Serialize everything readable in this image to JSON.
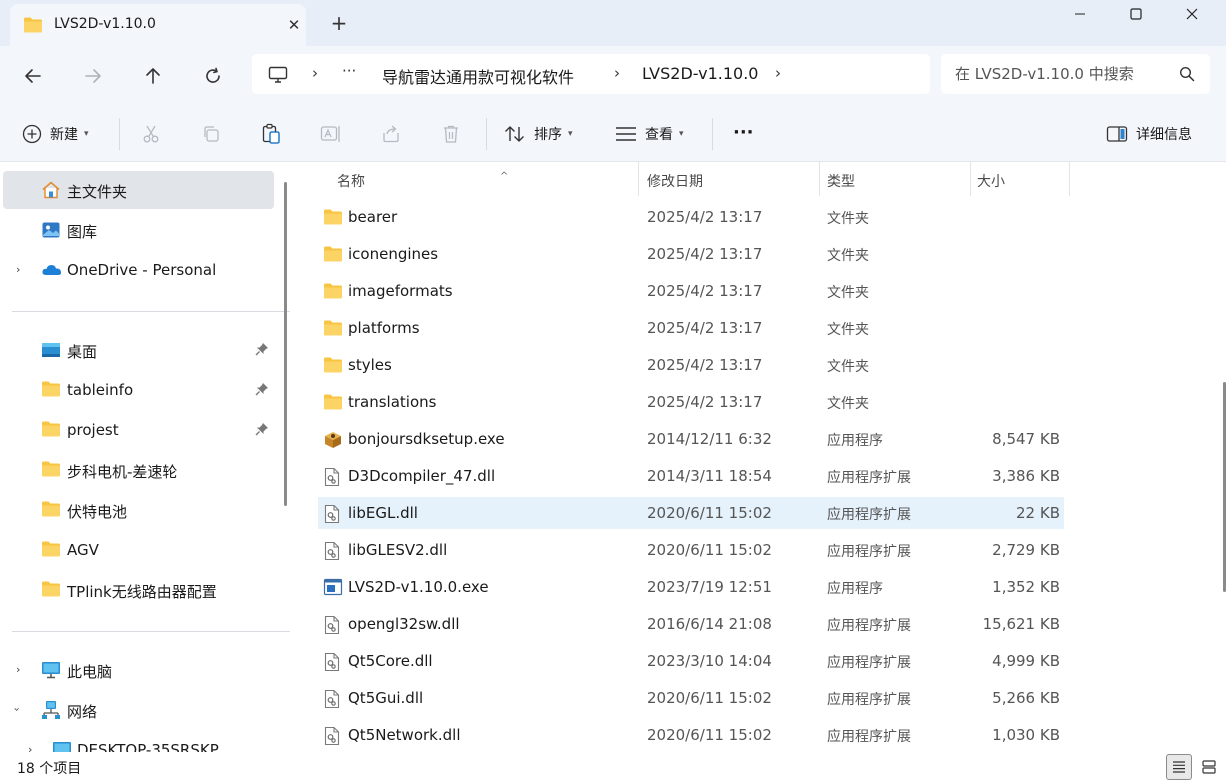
{
  "window": {
    "tab_title": "LVS2D-v1.10.0",
    "close_tab": "✕",
    "new_tab": "+"
  },
  "address": {
    "ellipsis": "···",
    "crumbs": [
      "导航雷达通用款可视化软件",
      "LVS2D-v1.10.0"
    ],
    "separator": "›"
  },
  "search": {
    "placeholder": "在 LVS2D-v1.10.0 中搜索"
  },
  "toolbar": {
    "new_label": "新建",
    "sort_label": "排序",
    "view_label": "查看",
    "more_label": "···",
    "details_label": "详细信息"
  },
  "sidebar": {
    "items": [
      {
        "label": "主文件夹",
        "icon": "home-icon"
      },
      {
        "label": "图库",
        "icon": "gallery-icon"
      },
      {
        "label": "OneDrive - Personal",
        "icon": "onedrive-icon"
      },
      {
        "label": "桌面",
        "icon": "desktop-icon"
      },
      {
        "label": "tableinfo",
        "icon": "folder-icon"
      },
      {
        "label": "projest",
        "icon": "folder-icon"
      },
      {
        "label": "步科电机-差速轮",
        "icon": "folder-icon"
      },
      {
        "label": "伏特电池",
        "icon": "folder-icon"
      },
      {
        "label": "AGV",
        "icon": "folder-icon"
      },
      {
        "label": "TPlink无线路由器配置",
        "icon": "folder-icon"
      },
      {
        "label": "此电脑",
        "icon": "pc-icon"
      },
      {
        "label": "网络",
        "icon": "network-icon"
      },
      {
        "label": "DESKTOP-35SRSKP",
        "icon": "pc-icon"
      }
    ]
  },
  "columns": {
    "name": "名称",
    "modified": "修改日期",
    "type": "类型",
    "size": "大小"
  },
  "files": [
    {
      "name": "bearer",
      "date": "2025/4/2 13:17",
      "type": "文件夹",
      "size": "",
      "kind": "folder"
    },
    {
      "name": "iconengines",
      "date": "2025/4/2 13:17",
      "type": "文件夹",
      "size": "",
      "kind": "folder"
    },
    {
      "name": "imageformats",
      "date": "2025/4/2 13:17",
      "type": "文件夹",
      "size": "",
      "kind": "folder"
    },
    {
      "name": "platforms",
      "date": "2025/4/2 13:17",
      "type": "文件夹",
      "size": "",
      "kind": "folder"
    },
    {
      "name": "styles",
      "date": "2025/4/2 13:17",
      "type": "文件夹",
      "size": "",
      "kind": "folder"
    },
    {
      "name": "translations",
      "date": "2025/4/2 13:17",
      "type": "文件夹",
      "size": "",
      "kind": "folder"
    },
    {
      "name": "bonjoursdksetup.exe",
      "date": "2014/12/11 6:32",
      "type": "应用程序",
      "size": "8,547 KB",
      "kind": "installer"
    },
    {
      "name": "D3Dcompiler_47.dll",
      "date": "2014/3/11 18:54",
      "type": "应用程序扩展",
      "size": "3,386 KB",
      "kind": "dll"
    },
    {
      "name": "libEGL.dll",
      "date": "2020/6/11 15:02",
      "type": "应用程序扩展",
      "size": "22 KB",
      "kind": "dll"
    },
    {
      "name": "libGLESV2.dll",
      "date": "2020/6/11 15:02",
      "type": "应用程序扩展",
      "size": "2,729 KB",
      "kind": "dll"
    },
    {
      "name": "LVS2D-v1.10.0.exe",
      "date": "2023/7/19 12:51",
      "type": "应用程序",
      "size": "1,352 KB",
      "kind": "exe"
    },
    {
      "name": "opengl32sw.dll",
      "date": "2016/6/14 21:08",
      "type": "应用程序扩展",
      "size": "15,621 KB",
      "kind": "dll"
    },
    {
      "name": "Qt5Core.dll",
      "date": "2023/3/10 14:04",
      "type": "应用程序扩展",
      "size": "4,999 KB",
      "kind": "dll"
    },
    {
      "name": "Qt5Gui.dll",
      "date": "2020/6/11 15:02",
      "type": "应用程序扩展",
      "size": "5,266 KB",
      "kind": "dll"
    },
    {
      "name": "Qt5Network.dll",
      "date": "2020/6/11 15:02",
      "type": "应用程序扩展",
      "size": "1,030 KB",
      "kind": "dll"
    }
  ],
  "status": {
    "item_count": "18 个项目"
  },
  "colors": {
    "folder": "#f8c543",
    "accent": "#0067c0",
    "hover_row": "#e5f1fb"
  }
}
